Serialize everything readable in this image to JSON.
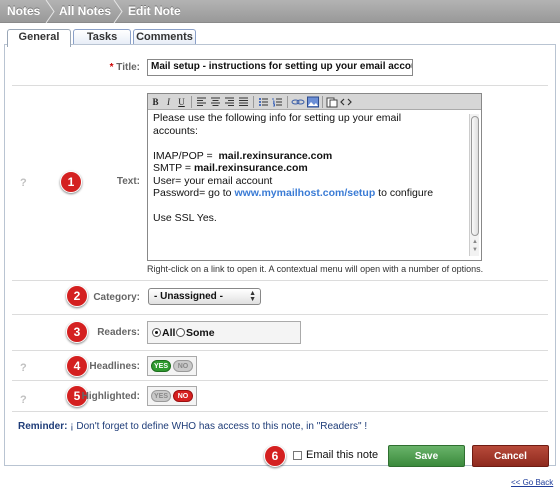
{
  "breadcrumb": {
    "items": [
      "Notes",
      "All Notes",
      "Edit Note"
    ]
  },
  "tabs": [
    {
      "label": "General",
      "active": true
    },
    {
      "label": "Tasks",
      "active": false
    },
    {
      "label": "Comments",
      "active": false
    }
  ],
  "form": {
    "title": {
      "required_mark": "*",
      "label": "Title:",
      "value": "Mail setup - instructions for setting up your email account"
    },
    "text": {
      "label": "Text:",
      "toolbar": [
        "B",
        "I",
        "U"
      ],
      "lines": {
        "l1": "Please use the following info for setting up your email",
        "l2": "accounts:",
        "imap_label": "IMAP/POP =",
        "imap_value": "mail.rexinsurance.com",
        "smtp_label": "SMTP =",
        "smtp_value": "mail.rexinsurance.com",
        "user": "User= your email account",
        "pass_label": "Password= go to",
        "pass_link": "www.mymailhost.com/setup",
        "pass_tail": "to configure",
        "ssl": "Use SSL Yes."
      },
      "hint": "Right-click on a link to open it. A contextual menu will open with a number of options."
    },
    "category": {
      "label": "Category:",
      "selected": "- Unassigned -"
    },
    "readers": {
      "label": "Readers:",
      "options": [
        "All",
        "Some"
      ],
      "selected": "All"
    },
    "headlines": {
      "label": "Headlines:",
      "yes": "YES",
      "no": "NO",
      "value": "YES"
    },
    "highlighted": {
      "label": "Highlighted:",
      "yes": "YES",
      "no": "NO",
      "value": "NO"
    }
  },
  "badges": [
    "1",
    "2",
    "3",
    "4",
    "5",
    "6"
  ],
  "reminder": {
    "label": "Reminder:",
    "text": "¡ Don't forget to define WHO has access to this note, in \"Readers\" !"
  },
  "footer": {
    "email_label": "Email this note",
    "save_label": "Save",
    "cancel_label": "Cancel",
    "go_back": "<< Go Back"
  },
  "colors": {
    "badge": "#d42020",
    "save": "#4a9a4b",
    "cancel": "#a33a2c",
    "link": "#3a7bd5"
  }
}
